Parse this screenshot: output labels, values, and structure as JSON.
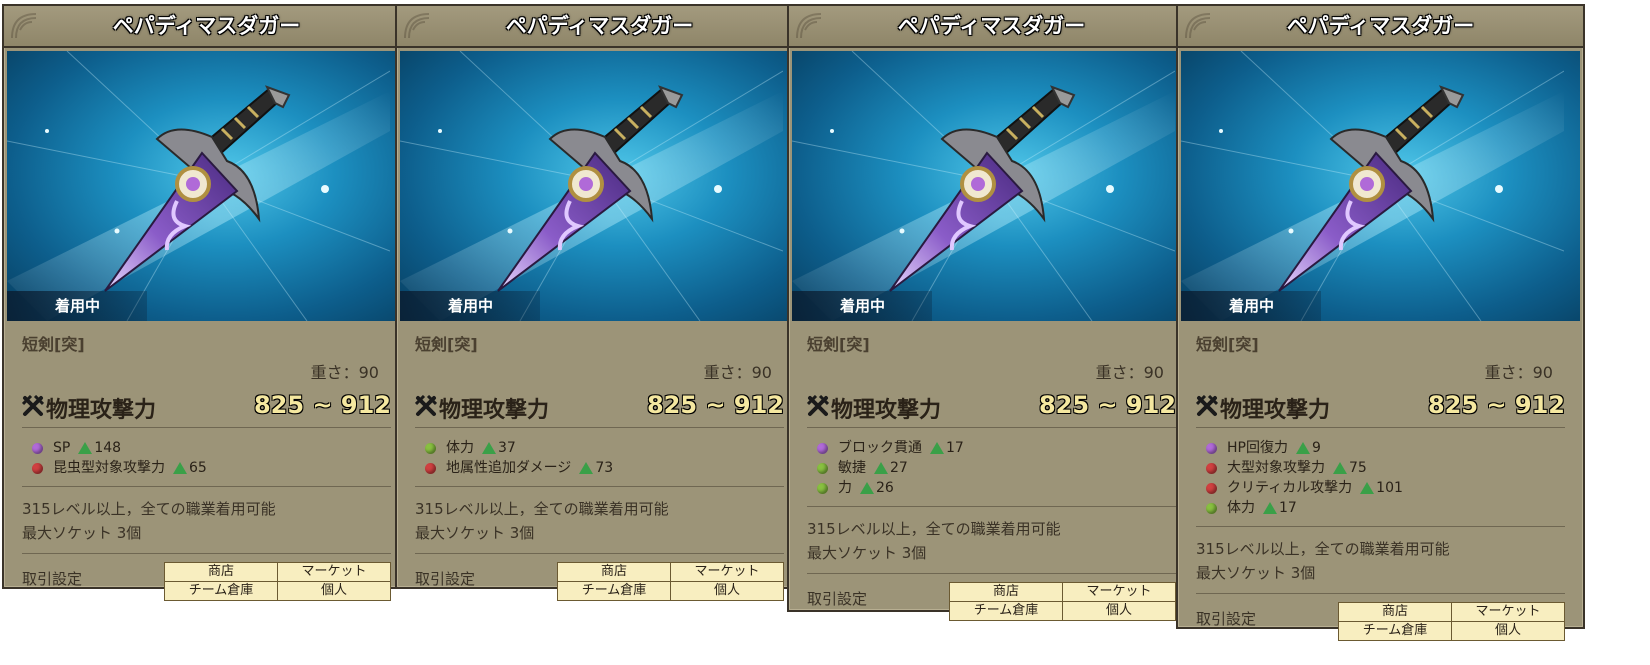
{
  "cards": [
    {
      "title": "ペパディマスダガー",
      "equip_status": "着用中",
      "item_type": "短剣[突]",
      "weight": "重さ：90",
      "attack_label": "物理攻撃力",
      "attack_value": "825 ~ 912",
      "options": [
        {
          "orb": "purple",
          "name": "SP",
          "value": "148"
        },
        {
          "orb": "red",
          "name": "昆虫型対象攻撃力",
          "value": "65"
        }
      ],
      "requirement": "315レベル以上，全ての職業着用可能",
      "sockets": "最大ソケット 3個",
      "trade_label": "取引設定",
      "trade_table": [
        [
          "商店",
          "マーケット"
        ],
        [
          "チーム倉庫",
          "個人"
        ]
      ]
    },
    {
      "title": "ペパディマスダガー",
      "equip_status": "着用中",
      "item_type": "短剣[突]",
      "weight": "重さ：90",
      "attack_label": "物理攻撃力",
      "attack_value": "825 ~ 912",
      "options": [
        {
          "orb": "green",
          "name": "体力",
          "value": "37"
        },
        {
          "orb": "red",
          "name": "地属性追加ダメージ",
          "value": "73"
        }
      ],
      "requirement": "315レベル以上，全ての職業着用可能",
      "sockets": "最大ソケット 3個",
      "trade_label": "取引設定",
      "trade_table": [
        [
          "商店",
          "マーケット"
        ],
        [
          "チーム倉庫",
          "個人"
        ]
      ]
    },
    {
      "title": "ペパディマスダガー",
      "equip_status": "着用中",
      "item_type": "短剣[突]",
      "weight": "重さ：90",
      "attack_label": "物理攻撃力",
      "attack_value": "825 ~ 912",
      "options": [
        {
          "orb": "purple",
          "name": "ブロック貫通",
          "value": "17"
        },
        {
          "orb": "green",
          "name": "敏捷",
          "value": "27"
        },
        {
          "orb": "green",
          "name": "力",
          "value": "26"
        }
      ],
      "requirement": "315レベル以上，全ての職業着用可能",
      "sockets": "最大ソケット 3個",
      "trade_label": "取引設定",
      "trade_table": [
        [
          "商店",
          "マーケット"
        ],
        [
          "チーム倉庫",
          "個人"
        ]
      ]
    },
    {
      "title": "ペパディマスダガー",
      "equip_status": "着用中",
      "item_type": "短剣[突]",
      "weight": "重さ：90",
      "attack_label": "物理攻撃力",
      "attack_value": "825 ~ 912",
      "options": [
        {
          "orb": "purple",
          "name": "HP回復力",
          "value": "9"
        },
        {
          "orb": "red",
          "name": "大型対象攻撃力",
          "value": "75"
        },
        {
          "orb": "red",
          "name": "クリティカル攻撃力",
          "value": "101"
        },
        {
          "orb": "green",
          "name": "体力",
          "value": "17"
        }
      ],
      "requirement": "315レベル以上，全ての職業着用可能",
      "sockets": "最大ソケット 3個",
      "trade_label": "取引設定",
      "trade_table": [
        [
          "商店",
          "マーケット"
        ],
        [
          "チーム倉庫",
          "個人"
        ]
      ]
    }
  ]
}
